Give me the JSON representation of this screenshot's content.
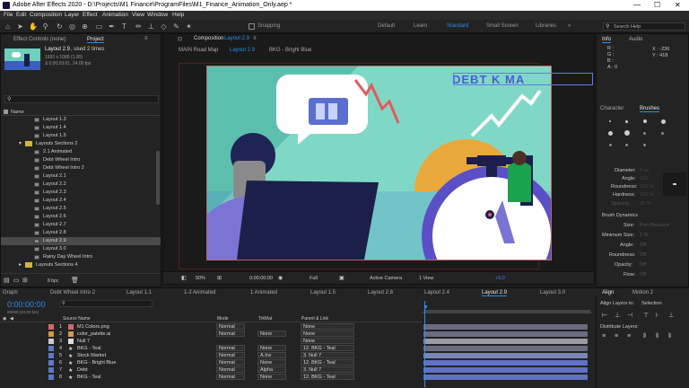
{
  "window": {
    "title": "Adobe After Effects 2020 - D:\\Projects\\M1 Finance\\ProgramFiles\\M1_Finance_Animation_Only.aep *"
  },
  "menu": [
    "File",
    "Edit",
    "Composition",
    "Layer",
    "Effect",
    "Animation",
    "View",
    "Window",
    "Help"
  ],
  "toolbar": {
    "snapping": "Snapping",
    "workspaces": [
      "Default",
      "Learn",
      "Standard",
      "Small Screen",
      "Libraries"
    ],
    "active_workspace": "Standard",
    "search_placeholder": "Search Help"
  },
  "left_panel": {
    "tabs": [
      "Effect Controls (none)",
      "Project"
    ],
    "active_tab": "Project",
    "thumbnail_name": "Layout 2.9",
    "thumbnail_used": ", used 2 times",
    "thumbnail_dims": "1920 x 1080 (1.00)",
    "thumbnail_dur": "Δ 0;00;03;01, 24.00 fps",
    "name_header": "Name",
    "items": [
      {
        "label": "Layout 1.3",
        "type": "comp"
      },
      {
        "label": "Layout 1.4",
        "type": "comp"
      },
      {
        "label": "Layout 1.5",
        "type": "comp"
      },
      {
        "label": "Layouts Sections 2",
        "type": "folder"
      },
      {
        "label": "2.1 Animated",
        "type": "comp"
      },
      {
        "label": "Debt Wheel Intro",
        "type": "comp"
      },
      {
        "label": "Debt Wheel Intro 2",
        "type": "comp"
      },
      {
        "label": "Layout 2.1",
        "type": "comp"
      },
      {
        "label": "Layout 2.2",
        "type": "comp"
      },
      {
        "label": "Layout 2.3",
        "type": "comp"
      },
      {
        "label": "Layout 2.4",
        "type": "comp"
      },
      {
        "label": "Layout 2.5",
        "type": "comp"
      },
      {
        "label": "Layout 2.6",
        "type": "comp"
      },
      {
        "label": "Layout 2.7",
        "type": "comp"
      },
      {
        "label": "Layout 2.8",
        "type": "comp"
      },
      {
        "label": "Layout 2.9",
        "type": "comp",
        "selected": true
      },
      {
        "label": "Layout 3.0",
        "type": "comp"
      },
      {
        "label": "Rainy Day Wheel Intro",
        "type": "comp"
      },
      {
        "label": "Layouts Sections 4",
        "type": "folder"
      }
    ],
    "bpc": "8 bpc"
  },
  "composition": {
    "header": "Composition",
    "comp_name": "Layout 2.9",
    "breadcrumbs": [
      "MAIN Road Map",
      "Layout 2.9",
      "BKG - Bright Blue"
    ],
    "stage_text": "DEBT  K MA",
    "footer": {
      "zoom": "50%",
      "time": "0;00;00;00",
      "resolution": "Full",
      "camera": "Active Camera",
      "views": "1 View",
      "exposure": "+0.0"
    }
  },
  "right_panel": {
    "tabs_top": [
      "Info",
      "Audio"
    ],
    "info": {
      "r": "R :",
      "g": "G :",
      "b": "B :",
      "a": "A : 0",
      "x": "X : -236",
      "y": "Y : 418"
    },
    "tabs_mid": [
      "Character",
      "Brushes"
    ],
    "brush_props": [
      "Diameter:",
      "Angle:",
      "Roundness:",
      "Hardness:",
      "Spacing"
    ],
    "brush_vals": [
      "9 px",
      "180 °",
      "100 %",
      "100 %",
      "25 %"
    ],
    "brush_dynamics": "Brush Dynamics",
    "dyn_props": [
      "Size:",
      "Minimum Size:",
      "Angle:",
      "Roundness:",
      "Opacity:",
      "Flow:"
    ],
    "dyn_vals": [
      "Pen Pressure",
      "1 %",
      "Off",
      "Off",
      "Off",
      "Off"
    ],
    "tabs_bottom": [
      "Align",
      "Motion 2"
    ],
    "align_to_label": "Align Layers to:",
    "align_to_value": "Selection",
    "distribute": "Distribute Layers:"
  },
  "timeline": {
    "tabs": [
      "Graph",
      "Debt Wheel Intro 2",
      "Layout 1.1",
      "1-2 Animated",
      "1 Animated",
      "Layout 1.5",
      "Layout 2.8",
      "Layout 2.4",
      "Layout 2.9",
      "Layout 3.0"
    ],
    "active_tab": "Layout 2.9",
    "timecode": "0:00:00:00",
    "fps": "00000 (24.00 fps)",
    "headers": {
      "source": "Source Name",
      "mode": "Mode",
      "trkmat": "TrkMat",
      "parent": "Parent & Link"
    },
    "layers": [
      {
        "num": "1",
        "name": "M1 Colors.png",
        "mode": "Normal",
        "trk": "",
        "parent": "None",
        "color": "#d06b6b",
        "bar": "#6b6b80"
      },
      {
        "num": "2",
        "name": "color_palette.ai",
        "mode": "Normal",
        "trk": "None",
        "parent": "None",
        "color": "#d09a4a",
        "bar": "#6b6b80"
      },
      {
        "num": "3",
        "name": "Null 7",
        "mode": "",
        "trk": "",
        "parent": "None",
        "color": "#cccccc",
        "bar": "#9a9aa6"
      },
      {
        "num": "4",
        "name": "BKG - Teal",
        "mode": "Normal",
        "trk": "None",
        "parent": "12. BKG - Teal",
        "color": "#5e77c8",
        "bar": "#6b6b80"
      },
      {
        "num": "5",
        "name": "Stock Market",
        "mode": "Normal",
        "trk": "A.Inv",
        "parent": "3. Null 7",
        "color": "#5e77c8",
        "bar": "#7a87b6"
      },
      {
        "num": "6",
        "name": "BKG - Bright Blue",
        "mode": "Normal",
        "trk": "None",
        "parent": "12. BKG - Teal",
        "color": "#5e77c8",
        "bar": "#5f72c4"
      },
      {
        "num": "7",
        "name": "Debt",
        "mode": "Normal",
        "trk": "Alpha",
        "parent": "3. Null 7",
        "color": "#5e77c8",
        "bar": "#5f72c4"
      },
      {
        "num": "8",
        "name": "BKG - Teal",
        "mode": "Normal",
        "trk": "None",
        "parent": "12. BKG - Teal",
        "color": "#5e77c8",
        "bar": "#5f72c4"
      }
    ]
  },
  "colors": {
    "accent": "#2d8ceb",
    "teal": "#6ecfbd",
    "navy": "#1c1f4a",
    "purple": "#7b74d4",
    "orange": "#e9a83c"
  }
}
